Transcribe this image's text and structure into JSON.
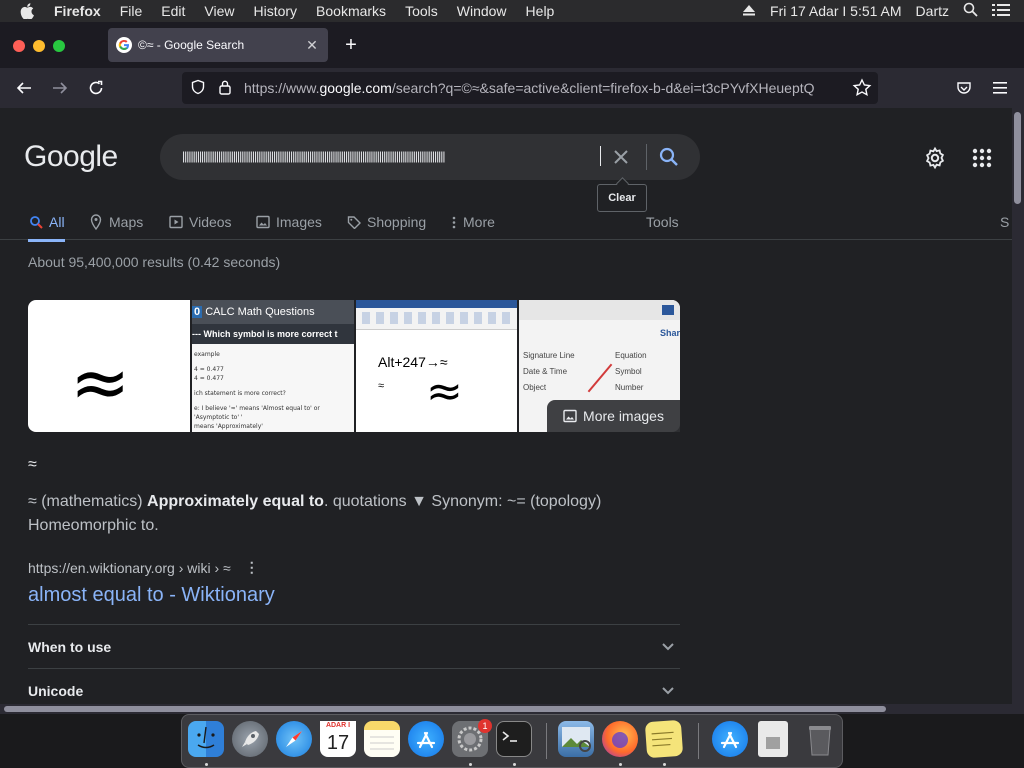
{
  "menubar": {
    "app_name": "Firefox",
    "items": [
      "File",
      "Edit",
      "View",
      "History",
      "Bookmarks",
      "Tools",
      "Window",
      "Help"
    ],
    "datetime": "Fri 17 Adar I  5:51 AM",
    "user": "Dartz"
  },
  "browser": {
    "tab_title": "©≈ - Google Search",
    "url_prefix": "https://www.",
    "url_host": "google.com",
    "url_rest": "/search?q=©≈&safe=active&client=firefox-b-d&ei=t3cPYvfXHeueptQ"
  },
  "search": {
    "query": "||||||||||||||||||||||||||||||||||||||||||||||||||||||||||||||||||||||||||||||||||||||||||||||||||||||||||||||||||||||||||||",
    "clear_tooltip": "Clear"
  },
  "logo": "Google",
  "tabs": [
    {
      "label": "All",
      "icon": "search-icon"
    },
    {
      "label": "Maps",
      "icon": "map-pin-icon"
    },
    {
      "label": "Videos",
      "icon": "video-icon"
    },
    {
      "label": "Images",
      "icon": "image-icon"
    },
    {
      "label": "Shopping",
      "icon": "tag-icon"
    },
    {
      "label": "More",
      "icon": "more-vertical-icon"
    }
  ],
  "tools_label": "Tools",
  "cutoff_label": "S",
  "stats": "About 95,400,000 results (0.42 seconds)",
  "image_strip": {
    "img1_symbol": "≈",
    "img2_header": "CALC   Math Questions",
    "img2_question": "--- Which symbol is more correct t",
    "img2_lines": [
      "example",
      "",
      "4 = 0.477",
      "4 = 0.477",
      "",
      "ich statement is more correct?",
      "",
      "e: I believe '≈' means 'Almost equal to' or 'Asymptotic to' '",
      "means 'Approximately'"
    ],
    "img3_text": "Alt+247→≈",
    "img3_small": "≈",
    "img3_symbol": "≈",
    "img4_items": [
      "Signature Line",
      "Date & Time",
      "Object",
      "Equation",
      "Symbol",
      "Number",
      "Shar"
    ],
    "more_images": "More images"
  },
  "result": {
    "symbol": "≈",
    "def_prefix": "≈ (mathematics) ",
    "def_bold": "Approximately equal to",
    "def_suffix": ". quotations ▼ Synonym: ~= (topology) Homeomorphic to.",
    "cite": "https://en.wiktionary.org › wiki › ≈",
    "title": "almost equal to - Wiktionary"
  },
  "accordions": [
    "When to use",
    "Unicode"
  ],
  "dock": {
    "calendar_month": "ADAR I",
    "calendar_day": "17",
    "settings_badge": "1"
  }
}
